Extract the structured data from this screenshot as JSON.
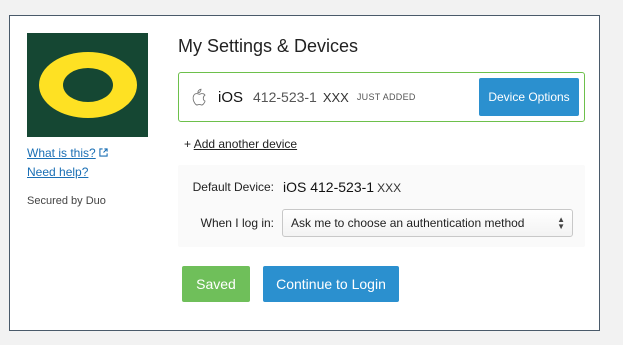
{
  "sidebar": {
    "logo_icon": "oregon-o-logo-icon",
    "logo_colors": {
      "background": "#154733",
      "letter": "#fee123"
    },
    "what_is_this": "What is this?",
    "what_is_this_icon": "external-link-icon",
    "need_help": "Need help?",
    "secured_by": "Secured by Duo"
  },
  "main": {
    "title": "My Settings & Devices",
    "device": {
      "icon": "apple-icon",
      "name": "iOS",
      "number": "412-523-1",
      "masked": "XXX",
      "badge": "JUST ADDED",
      "options_label": "Device Options"
    },
    "add_device_prefix": "+",
    "add_device": "Add another device",
    "settings": {
      "default_device_label": "Default Device:",
      "default_device_value": "iOS 412-523-1",
      "default_device_masked": "XXX",
      "login_label": "When I log in:",
      "login_selected": "Ask me to choose an authentication method"
    },
    "saved_label": "Saved",
    "continue_label": "Continue to Login"
  },
  "colors": {
    "primary": "#2b90cf",
    "success": "#6fbf5a",
    "card_border": "#6dc04b"
  }
}
